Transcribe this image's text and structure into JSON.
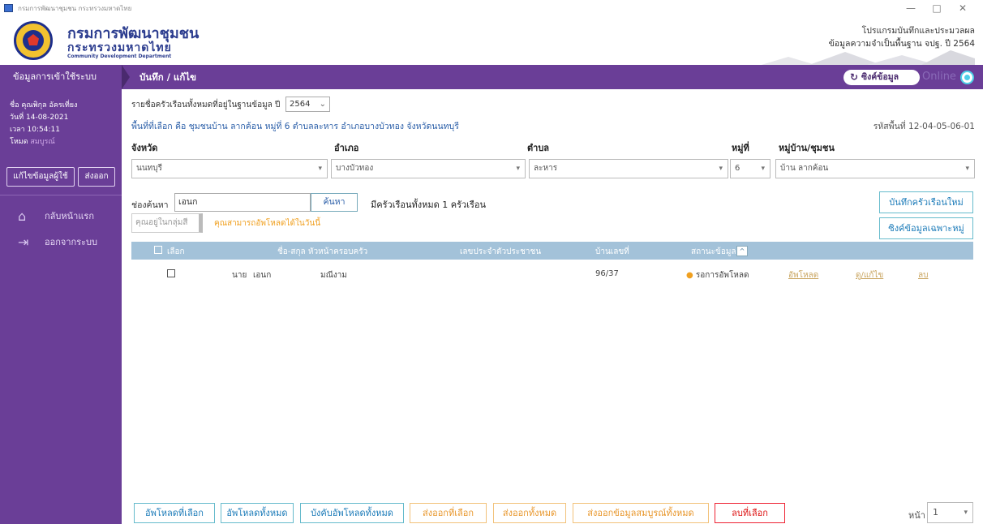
{
  "window": {
    "title": "กรมการพัฒนาชุมชน กระทรวงมหาดไทย",
    "minimize": "—",
    "maximize": "□",
    "close": "✕"
  },
  "header": {
    "org_name": "กรมการพัฒนาชุมชน",
    "ministry": "กระทรวงมหาดไทย",
    "english": "Community Development Department",
    "program_line1": "โปรแกรมบันทึกและประมวลผล",
    "program_line2": "ข้อมูลความจำเป็นพื้นฐาน จปฐ. ปี 2564"
  },
  "navbar": {
    "left_label": "ข้อมูลการเข้าใช้ระบบ",
    "page_title": "บันทึก / แก้ไข",
    "sync_label": "ซิงค์ข้อมูล",
    "sync_icon": "refresh-icon",
    "online_label": "Online"
  },
  "sidebar": {
    "user_name": "ชื่อ คุณพิกุล อัครเที่ยง",
    "date": "วันที่ 14-08-2021",
    "time": "เวลา 10:54:11",
    "mode_label": "โหมด",
    "mode_value": "สมบูรณ์",
    "edit_user_button": "แก้ไขข้อมูลผู้ใช้",
    "export_button": "ส่งออก",
    "menu": [
      {
        "label": "กลับหน้าแรก",
        "icon": "home-icon"
      },
      {
        "label": "ออกจากระบบ",
        "icon": "logout-icon"
      }
    ]
  },
  "main": {
    "year_prompt": "รายชื่อครัวเรือนทั้งหมดที่อยู่ในฐานข้อมูล ปี",
    "year_value": "2564",
    "area_text": "พื้นที่ที่เลือก คือ ชุมชนบ้าน ลากค้อน หมู่ที่ 6 ตำบลละหาร อำเภอบางบัวทอง จังหวัดนนทบุรี",
    "area_code": "รหัสพื้นที่ 12-04-05-06-01",
    "filters": {
      "province_label": "จังหวัด",
      "province_value": "นนทบุรี",
      "district_label": "อำเภอ",
      "district_value": "บางบัวทอง",
      "subdistrict_label": "ตำบล",
      "subdistrict_value": "ละหาร",
      "moo_label": "หมู่ที่",
      "moo_value": "6",
      "village_label": "หมู่บ้าน/ชุมชน",
      "village_value": "บ้าน ลากค้อน"
    },
    "search_label": "ช่องค้นหา",
    "search_value": "เอนก",
    "search_button": "ค้นหา",
    "count_text": "มีครัวเรือนทั้งหมด 1 ครัวเรือน",
    "group_placeholder": "คุณอยู่ในกลุ่มสี",
    "upload_note": "คุณสามารถอัพโหลดได้ในวันนี้",
    "new_household_button": "บันทึกครัวเรือนใหม่",
    "sync_village_button": "ซิงค์ข้อมูลเฉพาะหมู่",
    "table": {
      "headers": {
        "select": "เลือก",
        "name": "ชื่อ-สกุล หัวหน้าครอบครัว",
        "id": "เลขประจำตัวประชาชน",
        "house": "บ้านเลขที่",
        "status": "สถานะข้อมูล",
        "sort": "^"
      },
      "rows": [
        {
          "title": "นาย",
          "first": "เอนก",
          "last": "มณีงาม",
          "id": "",
          "house": "96/37",
          "status": "รอการอัพโหลด",
          "upload": "อัพโหลด",
          "edit": "ดู/แก้ไข",
          "delete": "ลบ"
        }
      ]
    },
    "bottom_buttons": {
      "upload_selected": "อัพโหลดที่เลือก",
      "upload_all": "อัพโหลดทั้งหมด",
      "force_upload_all": "บังคับอัพโหลดทั้งหมด",
      "export_selected": "ส่งออกที่เลือก",
      "export_all": "ส่งออกทั้งหมด",
      "export_complete_all": "ส่งออกข้อมูลสมบูรณ์ทั้งหมด",
      "delete_selected": "ลบที่เลือก"
    },
    "page_label": "หน้า",
    "page_value": "1"
  },
  "colors": {
    "nav_purple": "#6a3e97",
    "table_header": "#a3c2d9",
    "link_blue": "#1a7ab8",
    "orange": "#e8962a",
    "red": "#dd1111"
  }
}
